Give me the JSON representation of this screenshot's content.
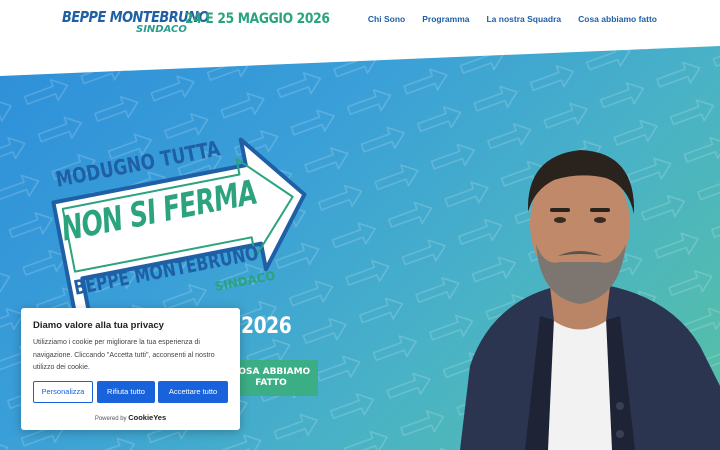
{
  "header": {
    "logo_name": "BEPPE MONTEBRUNO",
    "logo_role": "SINDACO",
    "dates": "24 E 25 MAGGIO 2026",
    "nav": [
      "Chi Sono",
      "Programma",
      "La nostra Squadra",
      "Cosa abbiamo fatto"
    ]
  },
  "hero": {
    "campaign_line1": "MODUGNO TUTTA",
    "campaign_line2": "NON SI FERMA",
    "campaign_line3": "BEPPE MONTEBRUNO",
    "campaign_line4": "SINDACO",
    "year_text": "2026",
    "cta_label_line1": "COSA ABBIAMO",
    "cta_label_line2": "FATTO"
  },
  "cookie": {
    "title": "Diamo valore alla tua privacy",
    "body": "Utilizziamo i cookie per migliorare la tua esperienza di navigazione. Cliccando \"Accetta tutti\", acconsenti al nostro utilizzo dei cookie.",
    "customize": "Personalizza",
    "reject": "Rifiuta tutto",
    "accept": "Accettare tutto",
    "powered_prefix": "Powered by",
    "powered_brand": "CookieYes"
  },
  "colors": {
    "brand_blue": "#1f5fa6",
    "brand_green": "#2aa37e",
    "cookie_button": "#1863dc"
  }
}
